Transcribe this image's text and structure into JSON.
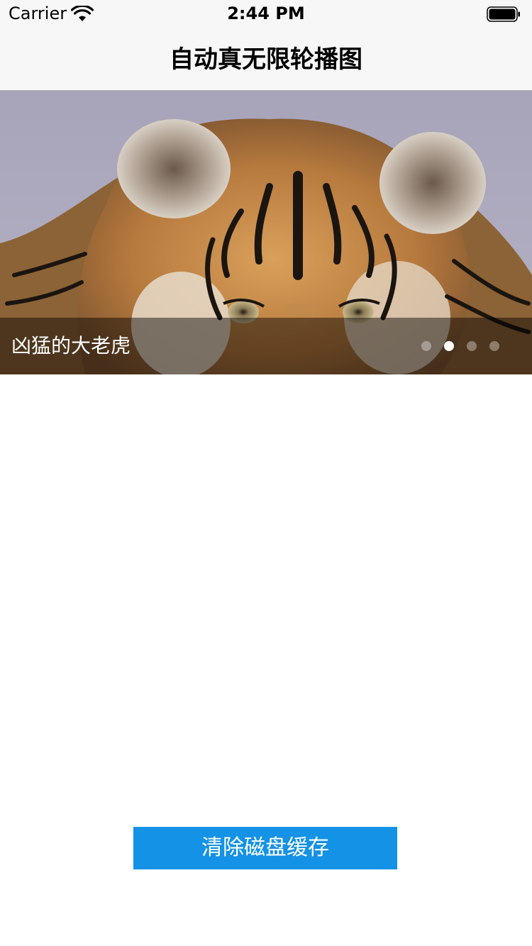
{
  "status_bar": {
    "carrier": "Carrier",
    "time": "2:44 PM",
    "wifi_icon": "wifi-icon",
    "battery_icon": "battery-icon"
  },
  "nav": {
    "title": "自动真无限轮播图"
  },
  "carousel": {
    "image": "tiger-photo",
    "caption": "凶猛的大老虎",
    "page_count": 4,
    "current_page": 2
  },
  "actions": {
    "clear_cache_label": "清除磁盘缓存"
  },
  "colors": {
    "accent": "#1492e6",
    "bar_background": "#f7f7f7"
  }
}
